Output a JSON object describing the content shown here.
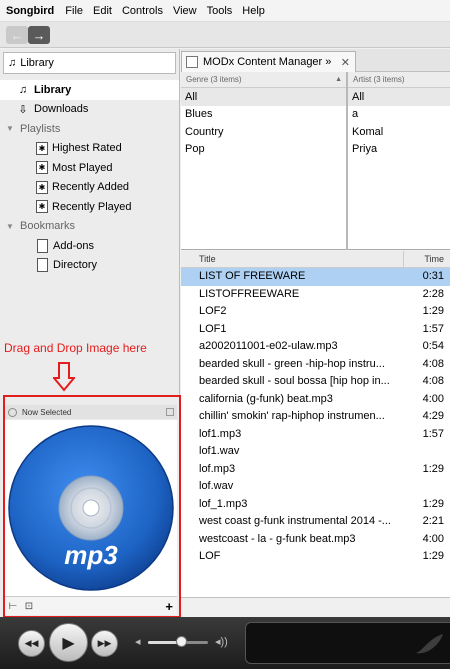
{
  "menubar": {
    "app_name": "Songbird",
    "menus": [
      "File",
      "Edit",
      "Controls",
      "View",
      "Tools",
      "Help"
    ]
  },
  "nav": {
    "back_icon": "arrow-left-icon",
    "forward_icon": "arrow-right-icon"
  },
  "sidebar": {
    "location_label": "Library",
    "items": [
      {
        "label": "Library",
        "icon": "library-icon",
        "selected": true
      },
      {
        "label": "Downloads",
        "icon": "download-icon"
      }
    ],
    "playlists_header": "Playlists",
    "playlists": [
      "Highest Rated",
      "Most Played",
      "Recently Added",
      "Recently Played"
    ],
    "bookmarks_header": "Bookmarks",
    "bookmarks": [
      "Add-ons",
      "Directory"
    ]
  },
  "annotation": {
    "text": "Drag and Drop Image here",
    "color": "#e51c1c"
  },
  "now_selected": {
    "title": "Now Selected",
    "art_label": "mp3",
    "add_button": "+"
  },
  "tab": {
    "label": "MODx Content Manager »",
    "close": "✕"
  },
  "filters": {
    "genre": {
      "header": "Genre (3 items)",
      "items": [
        "All",
        "Blues",
        "Country",
        "Pop"
      ]
    },
    "artist": {
      "header": "Artist (3 items)",
      "items": [
        "All",
        "a",
        "Komal",
        "Priya"
      ]
    }
  },
  "tracks": {
    "col_title": "Title",
    "col_time": "Time",
    "rows": [
      {
        "title": "LIST OF FREEWARE",
        "time": "0:31",
        "selected": true
      },
      {
        "title": "LISTOFFREEWARE",
        "time": "2:28"
      },
      {
        "title": "LOF2",
        "time": "1:29"
      },
      {
        "title": "LOF1",
        "time": "1:57"
      },
      {
        "title": "a2002011001-e02-ulaw.mp3",
        "time": "0:54"
      },
      {
        "title": "bearded skull - green -hip-hop instru...",
        "time": "4:08"
      },
      {
        "title": "bearded skull - soul bossa [hip hop in...",
        "time": "4:08"
      },
      {
        "title": "california (g-funk) beat.mp3",
        "time": "4:00"
      },
      {
        "title": "chillin' smokin' rap-hiphop instrumen...",
        "time": "4:29"
      },
      {
        "title": "lof1.mp3",
        "time": "1:57"
      },
      {
        "title": "lof1.wav",
        "time": ""
      },
      {
        "title": "lof.mp3",
        "time": "1:29"
      },
      {
        "title": "lof.wav",
        "time": ""
      },
      {
        "title": "lof_1.mp3",
        "time": "1:29"
      },
      {
        "title": "west coast g-funk instrumental 2014 -...",
        "time": "2:21"
      },
      {
        "title": "westcoast - la - g-funk beat.mp3",
        "time": "4:00"
      },
      {
        "title": "LOF",
        "time": "1:29"
      }
    ]
  },
  "player": {
    "prev_icon": "previous-track-icon",
    "play_icon": "play-icon",
    "next_icon": "next-track-icon",
    "volume_level": 0.55
  },
  "colors": {
    "selection": "#aed0f3",
    "disc": "#1d63c4",
    "annotation": "#e51c1c"
  }
}
